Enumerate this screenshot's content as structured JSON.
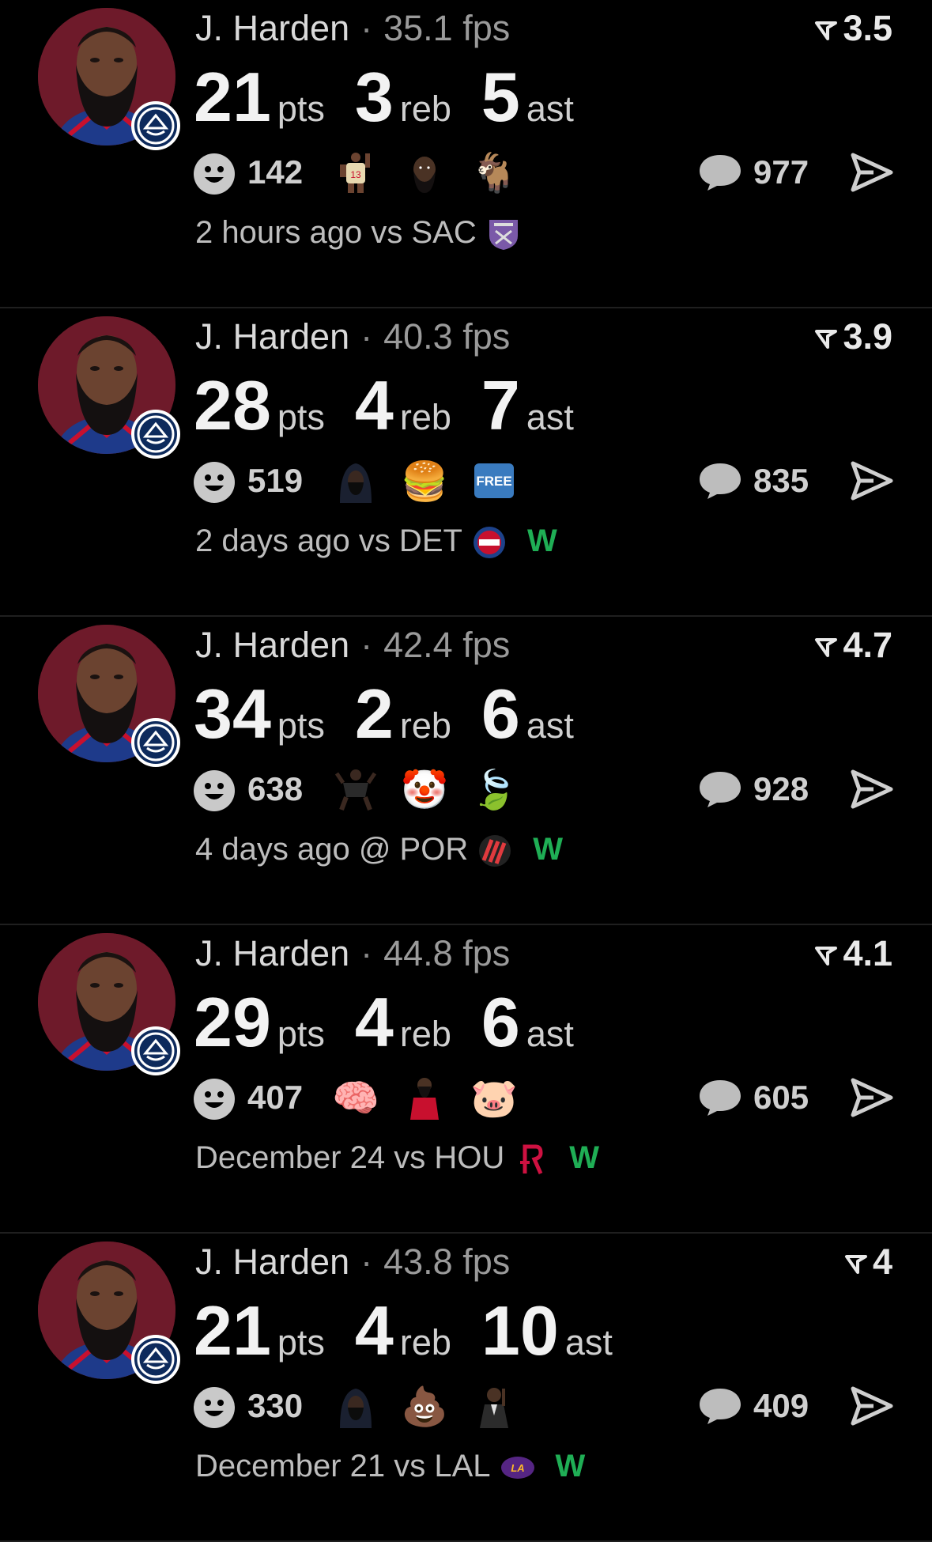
{
  "colors": {
    "background": "#000000",
    "win": "#1fae55",
    "avatar_bg": "#6e1a2a",
    "badge_bg": "#0d2a5c"
  },
  "cards": [
    {
      "player": "J. Harden",
      "separator": "·",
      "fps": "35.1 fps",
      "rating": "3.5",
      "pts": "21",
      "pts_label": "pts",
      "reb": "3",
      "reb_label": "reb",
      "ast": "5",
      "ast_label": "ast",
      "reactions": "142",
      "emojis": [
        "player-jersey-13",
        "bearded-face",
        "🐐"
      ],
      "comments": "977",
      "time": "2 hours ago vs SAC",
      "team_logo": "kings-logo",
      "result": ""
    },
    {
      "player": "J. Harden",
      "separator": "·",
      "fps": "40.3 fps",
      "rating": "3.9",
      "pts": "28",
      "pts_label": "pts",
      "reb": "4",
      "reb_label": "reb",
      "ast": "7",
      "ast_label": "ast",
      "reactions": "519",
      "emojis": [
        "hooded-figure",
        "🍔",
        "FREE"
      ],
      "comments": "835",
      "time": "2 days ago vs DET",
      "team_logo": "pistons-logo",
      "result": "W"
    },
    {
      "player": "J. Harden",
      "separator": "·",
      "fps": "42.4 fps",
      "rating": "4.7",
      "pts": "34",
      "pts_label": "pts",
      "reb": "2",
      "reb_label": "reb",
      "ast": "6",
      "ast_label": "ast",
      "reactions": "638",
      "emojis": [
        "player-dunking",
        "🤡",
        "🍃"
      ],
      "comments": "928",
      "time": "4 days ago @ POR",
      "team_logo": "blazers-logo",
      "result": "W"
    },
    {
      "player": "J. Harden",
      "separator": "·",
      "fps": "44.8 fps",
      "rating": "4.1",
      "pts": "29",
      "pts_label": "pts",
      "reb": "4",
      "reb_label": "reb",
      "ast": "6",
      "ast_label": "ast",
      "reactions": "407",
      "emojis": [
        "🧠",
        "player-red-jersey",
        "🐷"
      ],
      "comments": "605",
      "time": "December 24 vs HOU",
      "team_logo": "rockets-logo",
      "result": "W"
    },
    {
      "player": "J. Harden",
      "separator": "·",
      "fps": "43.8 fps",
      "rating": "4",
      "pts": "21",
      "pts_label": "pts",
      "reb": "4",
      "reb_label": "reb",
      "ast": "10",
      "ast_label": "ast",
      "reactions": "330",
      "emojis": [
        "hooded-figure",
        "💩",
        "man-in-suit"
      ],
      "comments": "409",
      "time": "December 21 vs LAL",
      "team_logo": "lakers-logo",
      "result": "W"
    }
  ]
}
